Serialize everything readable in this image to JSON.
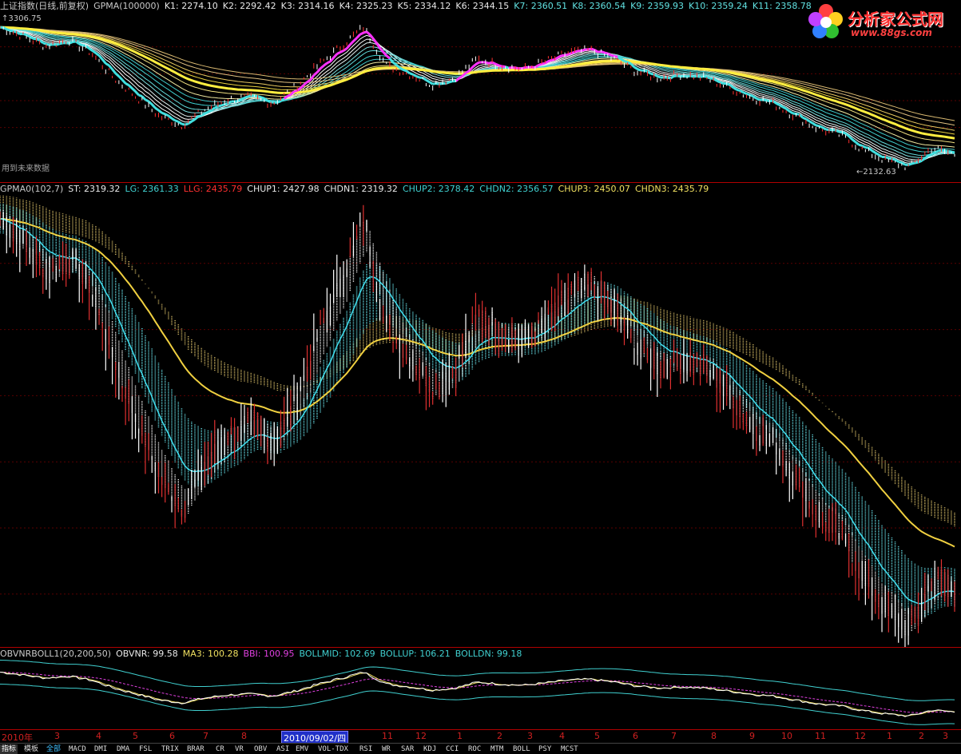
{
  "top_panel": {
    "header_items": [
      {
        "text": "上证指数(日线,前复权)",
        "color": "#c8c8c8"
      },
      {
        "text": "GPMA(100000)",
        "color": "#c8c8c8"
      },
      {
        "text": "K1: 2274.10",
        "color": "#e8e8e8"
      },
      {
        "text": "K2: 2292.42",
        "color": "#e8e8e8"
      },
      {
        "text": "K3: 2314.16",
        "color": "#e8e8e8"
      },
      {
        "text": "K4: 2325.23",
        "color": "#e8e8e8"
      },
      {
        "text": "K5: 2334.12",
        "color": "#e8e8e8"
      },
      {
        "text": "K6: 2344.15",
        "color": "#e8e8e8"
      },
      {
        "text": "K7: 2360.51",
        "color": "#60e0e0"
      },
      {
        "text": "K8: 2360.54",
        "color": "#60e0e0"
      },
      {
        "text": "K9: 2359.93",
        "color": "#60e0e0"
      },
      {
        "text": "K10: 2359.24",
        "color": "#60e0e0"
      },
      {
        "text": "K11: 2358.78",
        "color": "#60e0e0"
      }
    ],
    "high_label": "3306.75",
    "low_label": "←2132.63",
    "future_note": "用到未来数据"
  },
  "middle_panel": {
    "header_items": [
      {
        "text": "GPMA0(102,7)",
        "color": "#c8c8c8"
      },
      {
        "text": "ST: 2319.32",
        "color": "#e8e8e8"
      },
      {
        "text": "LG: 2361.33",
        "color": "#40d0d0"
      },
      {
        "text": "LLG: 2435.79",
        "color": "#ff3030"
      },
      {
        "text": "CHUP1: 2427.98",
        "color": "#e8e8e8"
      },
      {
        "text": "CHDN1: 2319.32",
        "color": "#e8e8e8"
      },
      {
        "text": "CHUP2: 2378.42",
        "color": "#40d0d0"
      },
      {
        "text": "CHDN2: 2356.57",
        "color": "#40d0d0"
      },
      {
        "text": "CHUP3: 2450.07",
        "color": "#f0e060"
      },
      {
        "text": "CHDN3: 2435.79",
        "color": "#f0e060"
      }
    ]
  },
  "bottom_panel": {
    "header_items": [
      {
        "text": "OBVNRBOLL1(20,200,50)",
        "color": "#c8c8c8"
      },
      {
        "text": "OBVNR: 99.58",
        "color": "#e8e8e8"
      },
      {
        "text": "MA3: 100.28",
        "color": "#f0e060"
      },
      {
        "text": "BBI: 100.95",
        "color": "#e040e0"
      },
      {
        "text": "BOLLMID: 102.69",
        "color": "#40d0d0"
      },
      {
        "text": "BOLLUP: 106.21",
        "color": "#40d0d0"
      },
      {
        "text": "BOLLDN: 99.18",
        "color": "#40d0d0"
      }
    ]
  },
  "x_axis": {
    "ticks": [
      "2010年",
      "3",
      "4",
      "5",
      "6",
      "7",
      "8",
      "2010/09/02/四",
      "11",
      "12",
      "1",
      "2",
      "3",
      "4",
      "5",
      "6",
      "7",
      "8",
      "9",
      "10",
      "11",
      "12",
      "1",
      "2",
      "3"
    ],
    "selected_index": 7
  },
  "tabs": [
    "指标",
    "模板",
    "全部",
    "MACD",
    "DMI",
    "DMA",
    "FSL",
    "TRIX",
    "BRAR",
    "CR",
    "VR",
    "OBV",
    "ASI",
    "EMV",
    "VOL-TDX",
    "RSI",
    "WR",
    "SAR",
    "KDJ",
    "CCI",
    "ROC",
    "MTM",
    "BOLL",
    "PSY",
    "MCST"
  ],
  "active_tab": "全部",
  "logo": {
    "name": "分析家公式网",
    "url": "www.88gs.com"
  },
  "chart_data": [
    {
      "type": "line",
      "title": "上证指数(日线,前复权) GPMA(100000)",
      "y_labels": [
        "3306.75",
        "2132.63"
      ],
      "series": [
        {
          "name": "K1",
          "last": 2274.1
        },
        {
          "name": "K2",
          "last": 2292.42
        },
        {
          "name": "K3",
          "last": 2314.16
        },
        {
          "name": "K4",
          "last": 2325.23
        },
        {
          "name": "K5",
          "last": 2334.12
        },
        {
          "name": "K6",
          "last": 2344.15
        },
        {
          "name": "K7",
          "last": 2360.51
        },
        {
          "name": "K8",
          "last": 2360.54
        },
        {
          "name": "K9",
          "last": 2359.93
        },
        {
          "name": "K10",
          "last": 2359.24
        },
        {
          "name": "K11",
          "last": 2358.78
        }
      ],
      "price_path": [
        3250,
        3180,
        3100,
        3150,
        3050,
        2850,
        2700,
        2550,
        2480,
        2600,
        2680,
        2700,
        2650,
        2780,
        2950,
        3100,
        3250,
        2950,
        2880,
        2800,
        2850,
        3000,
        2950,
        2920,
        2980,
        3050,
        3070,
        3000,
        2900,
        2850,
        2880,
        2850,
        2780,
        2700,
        2650,
        2550,
        2450,
        2400,
        2280,
        2200,
        2150,
        2300,
        2250
      ]
    },
    {
      "type": "area",
      "title": "GPMA0(102,7)",
      "series": [
        {
          "name": "ST",
          "last": 2319.32
        },
        {
          "name": "LG",
          "last": 2361.33
        },
        {
          "name": "LLG",
          "last": 2435.79
        },
        {
          "name": "CHUP1",
          "last": 2427.98
        },
        {
          "name": "CHDN1",
          "last": 2319.32
        },
        {
          "name": "CHUP2",
          "last": 2378.42
        },
        {
          "name": "CHDN2",
          "last": 2356.57
        },
        {
          "name": "CHUP3",
          "last": 2450.07
        },
        {
          "name": "CHDN3",
          "last": 2435.79
        }
      ]
    },
    {
      "type": "line",
      "title": "OBVNRBOLL1(20,200,50)",
      "series": [
        {
          "name": "OBVNR",
          "last": 99.58
        },
        {
          "name": "MA3",
          "last": 100.28
        },
        {
          "name": "BBI",
          "last": 100.95
        },
        {
          "name": "BOLLMID",
          "last": 102.69
        },
        {
          "name": "BOLLUP",
          "last": 106.21
        },
        {
          "name": "BOLLDN",
          "last": 99.18
        }
      ]
    }
  ]
}
